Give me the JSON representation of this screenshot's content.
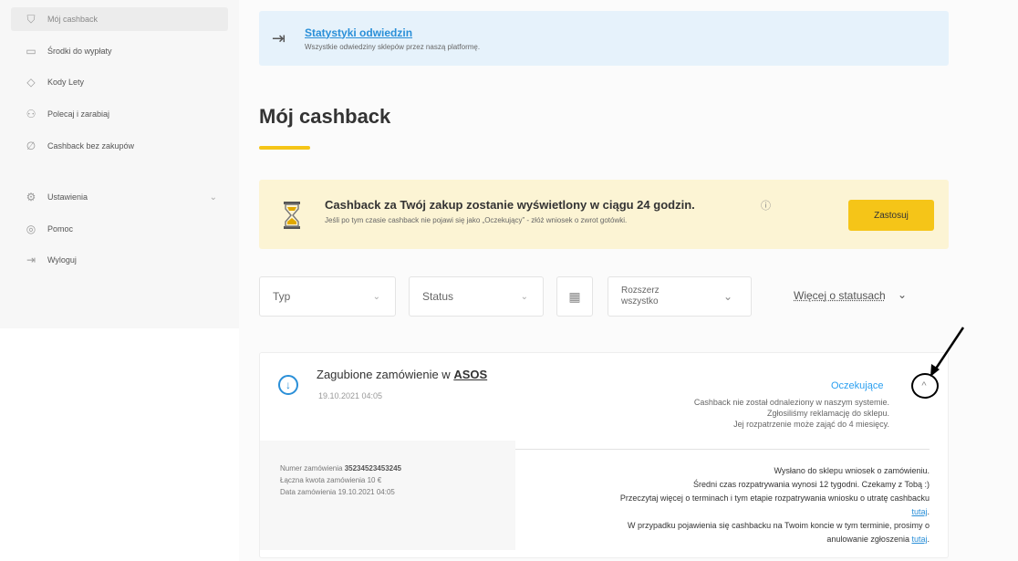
{
  "sidebar": {
    "items": [
      {
        "label": "Mój cashback",
        "icon": "bag-icon",
        "glyph": "⛉"
      },
      {
        "label": "Środki do wypłaty",
        "icon": "wallet-icon",
        "glyph": "▭"
      },
      {
        "label": "Kody Lety",
        "icon": "tag-icon",
        "glyph": "◇"
      },
      {
        "label": "Polecaj i zarabiaj",
        "icon": "user-plus-icon",
        "glyph": "⚇"
      },
      {
        "label": "Cashback bez zakupów",
        "icon": "link-icon",
        "glyph": "∅"
      },
      {
        "label": "Ustawienia",
        "icon": "gear-icon",
        "glyph": "⚙",
        "chevron": "⌄"
      },
      {
        "label": "Pomoc",
        "icon": "help-icon",
        "glyph": "◎"
      },
      {
        "label": "Wyloguj",
        "icon": "logout-icon",
        "glyph": "⇥"
      }
    ]
  },
  "stats_banner": {
    "icon_glyph": "⇥",
    "title": "Statystyki odwiedzin",
    "desc": "Wszystkie odwiedziny sklepów przez naszą platformę."
  },
  "page": {
    "title": "Mój cashback"
  },
  "info_banner": {
    "title": "Cashback za Twój zakup zostanie wyświetlony w ciągu 24 godzin.",
    "info_glyph": "ⓘ",
    "desc": "Jeśli po tym czasie cashback nie pojawi się jako „Oczekujący” - złóż wniosek o zwrot gotówki.",
    "button": "Zastosuj"
  },
  "filters": {
    "type": "Typ",
    "status": "Status",
    "calendar_glyph": "▦",
    "expand": "Rozszerz wszystko",
    "more_statuses": "Więcej o statusach",
    "chevron": "⌄",
    "double_chevron": "⌄",
    "more_chevron": "⌄"
  },
  "order": {
    "icon_glyph": "↓",
    "title_prefix": "Zagubione zamówienie w ",
    "shop": "ASOS",
    "date": "19.10.2021 04:05",
    "status": "Oczekujące",
    "collapse_glyph": "^",
    "status_desc": [
      "Cashback nie został odnaleziony w naszym systemie.",
      "Zgłosiliśmy reklamację do sklepu.",
      "Jej rozpatrzenie może zająć do 4 miesięcy."
    ],
    "details": {
      "number_label": "Numer zamówienia ",
      "number": "35234523453245",
      "amount": "Łączna kwota zamówienia 10 €",
      "date": "Data zamówienia 19.10.2021 04:05"
    },
    "note": {
      "line1": "Wysłano do sklepu wniosek o zamówieniu.",
      "line2": "Średni czas rozpatrywania wynosi 12 tygodni. Czekamy z Tobą :)",
      "line3": "Przeczytaj więcej o terminach i tym etapie rozpatrywania wniosku o utratę cashbacku ",
      "link1": "tutaj",
      "line4": "W przypadku pojawienia się cashbacku na Twoim koncie w tym terminie, prosimy o anulowanie zgłoszenia ",
      "link2": "tutaj",
      "period": "."
    }
  }
}
